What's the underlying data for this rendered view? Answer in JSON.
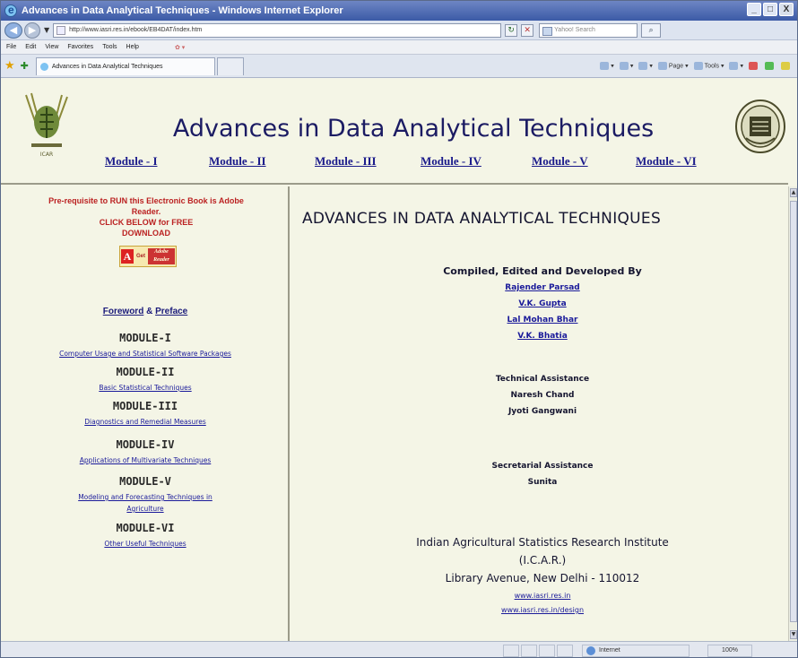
{
  "window": {
    "title": "Advances in Data Analytical Techniques - Windows Internet Explorer",
    "minimize": "_",
    "maximize": "□",
    "close": "X"
  },
  "address": {
    "url": "http://www.iasri.res.in/ebook/EB4DAT/index.htm",
    "search_placeholder": "Yahoo! Search"
  },
  "menu": [
    "File",
    "Edit",
    "View",
    "Favorites",
    "Tools",
    "Help"
  ],
  "tab": {
    "label": "Advances in Data Analytical Techniques"
  },
  "command_bar": {
    "page": "Page",
    "tools": "Tools"
  },
  "header": {
    "title": "Advances in Data Analytical Techniques",
    "left_logo_caption": "ICAR",
    "modules": [
      "Module - I",
      "Module - II",
      "Module - III",
      "Module - IV",
      "Module - V",
      "Module - VI"
    ]
  },
  "sidebar": {
    "prereq_line1": "Pre-requisite to RUN this Electronic Book is Adobe",
    "prereq_line2": "Reader.",
    "prereq_line3": "CLICK BELOW for FREE",
    "prereq_line4": "DOWNLOAD",
    "adobe_get": "Get",
    "adobe_reader": "Adobe Reader",
    "foreword": "Foreword",
    "ampersand": "&",
    "preface": "Preface",
    "modules": [
      {
        "heading": "MODULE-I",
        "link": "Computer Usage and Statistical Software Packages"
      },
      {
        "heading": "MODULE-II",
        "link": "Basic Statistical Techniques"
      },
      {
        "heading": "MODULE-III",
        "link": "Diagnostics and Remedial Measures"
      },
      {
        "heading": "MODULE-IV",
        "link": "Applications of Multivariate Techniques"
      },
      {
        "heading": "MODULE-V",
        "link": "Modeling and Forecasting Techniques in",
        "link2": "Agriculture"
      },
      {
        "heading": "MODULE-VI",
        "link": "Other Useful Techniques"
      }
    ]
  },
  "main": {
    "title": "ADVANCES IN DATA ANALYTICAL TECHNIQUES",
    "compiled_label": "Compiled, Edited and Developed By",
    "authors": [
      "Rajender Parsad",
      "V.K. Gupta",
      "Lal Mohan Bhar",
      "V.K. Bhatia"
    ],
    "technical_label": "Technical Assistance",
    "technical_names": [
      "Naresh Chand",
      "Jyoti Gangwani"
    ],
    "secretarial_label": "Secretarial Assistance",
    "secretarial_name": "Sunita",
    "institute_line1": "Indian Agricultural Statistics Research Institute",
    "institute_line2": "(I.C.A.R.)",
    "institute_line3": "Library Avenue, New Delhi - 110012",
    "web1": "www.iasri.res.in",
    "web2": "www.iasri.res.in/design"
  },
  "status": {
    "zone": "Internet",
    "zoom": "100%"
  }
}
